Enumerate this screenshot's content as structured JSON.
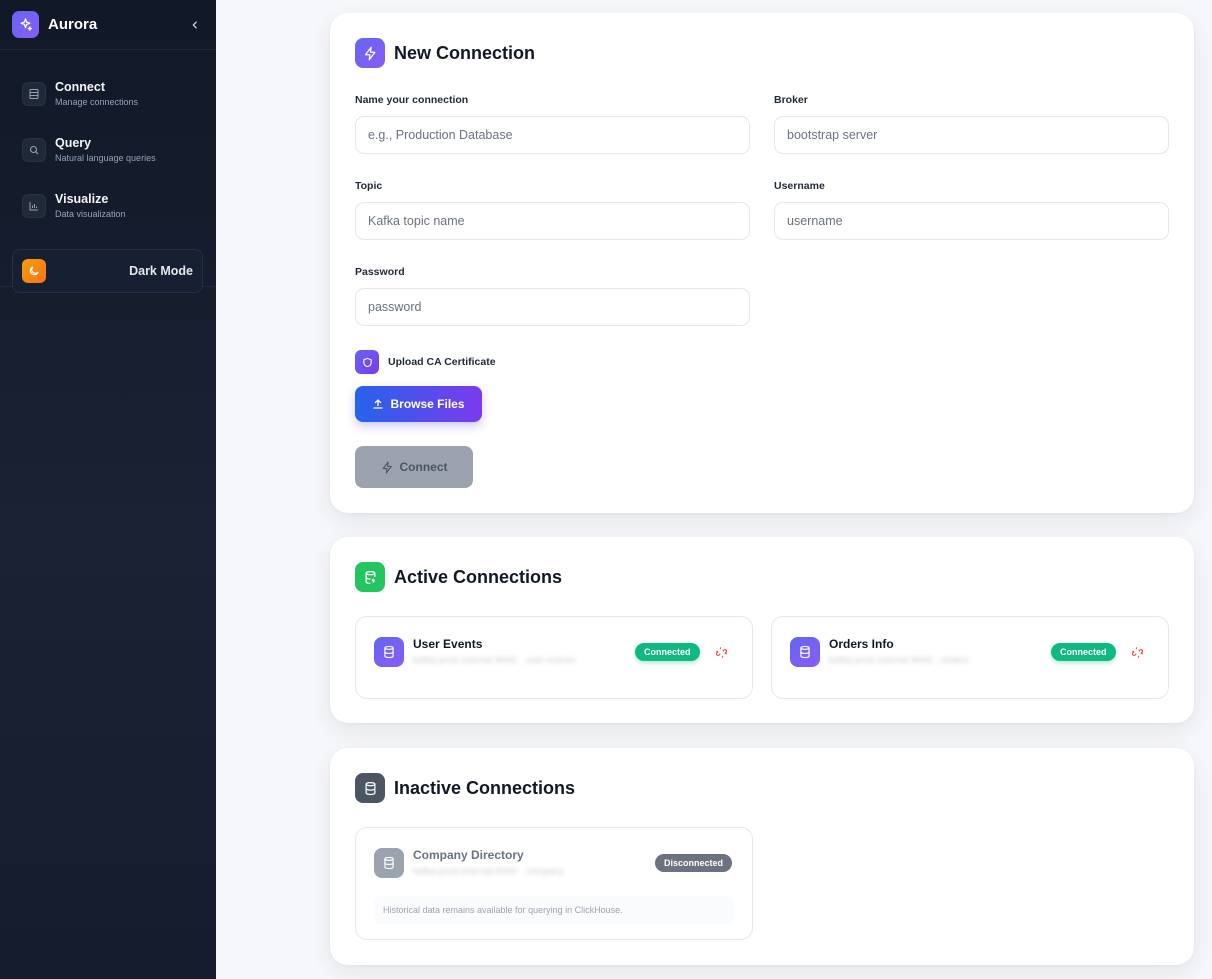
{
  "app": {
    "name": "Aurora",
    "accent": "#6366f1"
  },
  "sidebar": {
    "items": [
      {
        "label": "Connect",
        "sub": "Manage connections",
        "icon": "database-icon"
      },
      {
        "label": "Query",
        "sub": "Natural language queries",
        "icon": "search-icon"
      },
      {
        "label": "Visualize",
        "sub": "Data visualization",
        "icon": "bar-chart-icon"
      }
    ],
    "dark_mode_label": "Dark Mode"
  },
  "new_connection": {
    "title": "New Connection",
    "fields": {
      "name": {
        "label": "Name your connection",
        "placeholder": "e.g., Production Database",
        "value": ""
      },
      "broker": {
        "label": "Broker",
        "placeholder": "bootstrap server",
        "value": ""
      },
      "topic": {
        "label": "Topic",
        "placeholder": "Kafka topic name",
        "value": ""
      },
      "username": {
        "label": "Username",
        "placeholder": "username",
        "value": ""
      },
      "password": {
        "label": "Password",
        "placeholder": "password",
        "value": ""
      }
    },
    "upload_label": "Upload CA Certificate",
    "browse_label": "Browse Files",
    "connect_label": "Connect"
  },
  "active_connections": {
    "title": "Active Connections",
    "items": [
      {
        "name": "User Events",
        "meta": "kafka.prod.internal:9092 · user-events",
        "status": "Connected"
      },
      {
        "name": "Orders Info",
        "meta": "kafka.prod.internal:9092 · orders",
        "status": "Connected"
      }
    ]
  },
  "inactive_connections": {
    "title": "Inactive Connections",
    "items": [
      {
        "name": "Company Directory",
        "meta": "kafka.prod.internal:9092 · company",
        "status": "Disconnected",
        "note": "Historical data remains available for querying in ClickHouse."
      }
    ]
  },
  "colors": {
    "connected": "#10b981",
    "disconnected": "#6b7280",
    "active_icon": "#22c55e",
    "inactive_icon": "#4b5563"
  }
}
